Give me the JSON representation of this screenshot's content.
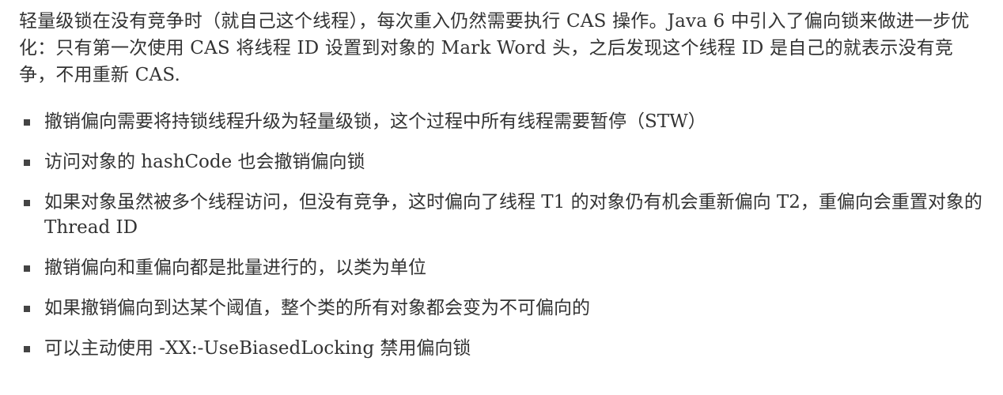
{
  "document": {
    "paragraph": "轻量级锁在没有竞争时（就自己这个线程），每次重入仍然需要执行 CAS 操作。Java 6 中引入了偏向锁来做进一步优化：只有第一次使用 CAS 将线程 ID 设置到对象的 Mark Word 头，之后发现这个线程 ID 是自己的就表示没有竞争，不用重新 CAS.",
    "bullets": [
      "撤销偏向需要将持锁线程升级为轻量级锁，这个过程中所有线程需要暂停（STW）",
      "访问对象的 hashCode 也会撤销偏向锁",
      "如果对象虽然被多个线程访问，但没有竞争，这时偏向了线程 T1 的对象仍有机会重新偏向 T2，重偏向会重置对象的 Thread ID",
      "撤销偏向和重偏向都是批量进行的，以类为单位",
      "如果撤销偏向到达某个阈值，整个类的所有对象都会变为不可偏向的",
      "可以主动使用 -XX:-UseBiasedLocking 禁用偏向锁"
    ]
  }
}
